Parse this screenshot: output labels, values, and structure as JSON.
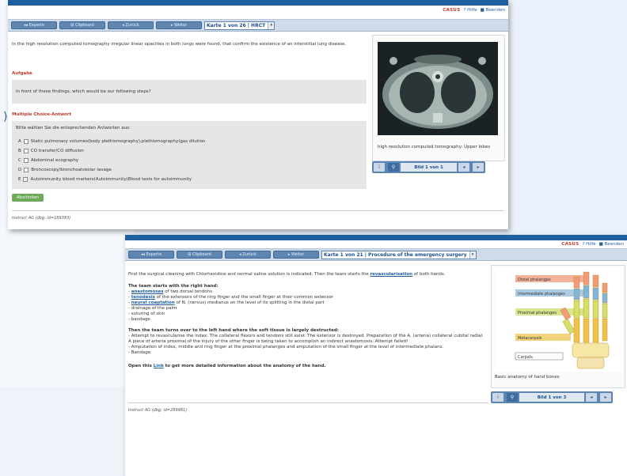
{
  "shot1": {
    "toolbar": {
      "logo": "CASUS",
      "help": "Hilfe",
      "end": "Beenden"
    },
    "nav": {
      "b1": "Experte",
      "b2": "Clipboard",
      "b3": "Zurück",
      "b4": "Weiter",
      "card": "Karte 1 von 26 | HRCT"
    },
    "intro": "In the high resolution computed tomography irregular linear opacities in both lungs were found, that confirm the existence of an interstitial lung disease.",
    "task_label": "Aufgabe",
    "task_text": "In front of these findings, which would be our following steps?",
    "mc_label": "Multiple Choice-Antwort",
    "mc_instruction": "Bitte wählen Sie die entsprechenden Antworten aus:",
    "answers": [
      {
        "letter": "A",
        "text": "Static pulmonary volumes(body plethismography),plethismography)gas dilution"
      },
      {
        "letter": "B",
        "text": "CO transfer/CO diffusion"
      },
      {
        "letter": "C",
        "text": "Abdominal ecography"
      },
      {
        "letter": "D",
        "text": "Broncoscopy/bronchoalveolar lavage"
      },
      {
        "letter": "E",
        "text": "Autoimmunity blood markers(Autoimmunity(Blood tests for autoimmunity"
      }
    ],
    "submit": "Abschicken",
    "footer": "Instruct AG (dbg: id=189383)",
    "image_caption": "high resolution computed tomography: Upper lobes",
    "pager": "Bild 1 von 1"
  },
  "shot2": {
    "toolbar": {
      "logo": "CASUS",
      "help": "Hilfe",
      "end": "Beenden"
    },
    "nav": {
      "b1": "Experte",
      "b2": "Clipboard",
      "b3": "Zurück",
      "b4": "Weiter",
      "card": "Karte 1 von 21 | Procedure of the emergency surgery"
    },
    "p1_a": "First the surgical cleaning with Chlorhexidine and normal saline solution is indicated. Then the team starts the ",
    "p1_link": "revascularisation",
    "p1_b": " of both hands.",
    "right_head": "The team starts with the right hand:",
    "r1_link": "anastomoses",
    "r1_rest": " of two dorsal tendons",
    "r2_link": "tenodesis",
    "r2_rest": " of the extensors of the ring finger and the small finger at their common extensor",
    "r3_link": "neural coaptation",
    "r3_rest": " of N. (nervus) medianus on the level of its splitting in the distal part",
    "r4": "- drainage of the palm",
    "r5": "- suturing of skin",
    "r6": "- bandage",
    "left_head": "Then the team turns over to the left hand where the soft tissue is largely destructed:",
    "l1": "- Attempt to revascularise the index: The collateral flexors and tendons still exist. The extensor is destroyed. Preparation of the A. (arteria) collateral cubital radial.",
    "l2": "A piece of arteria proximal of the injury of the other finger is being taken to accomplish an indirect anastomosis: Attempt failed!",
    "l3": "- Amputation of index, middle and ring finger at the proximal phalanges and amputation of the small finger at the level of intermediate phalanx.",
    "l4": "- Bandage",
    "open_a": "Open this ",
    "open_link": "Link",
    "open_b": " to get more detailed information about the anatomy of the hand.",
    "footer": "Instruct AG (dbg: id=289981)",
    "hand_labels": [
      "Distal phalanges",
      "Intermediate phalanges",
      "Proximal phalanges",
      "Metacarpals",
      "Carpals"
    ],
    "image_caption": "Basic anatomy of hand bones",
    "pager": "Bild 1 von 3"
  },
  "colors": {
    "topbar": "#1f5f9f",
    "accent_red": "#c0392b",
    "nav_blue": "#5f86b1"
  }
}
